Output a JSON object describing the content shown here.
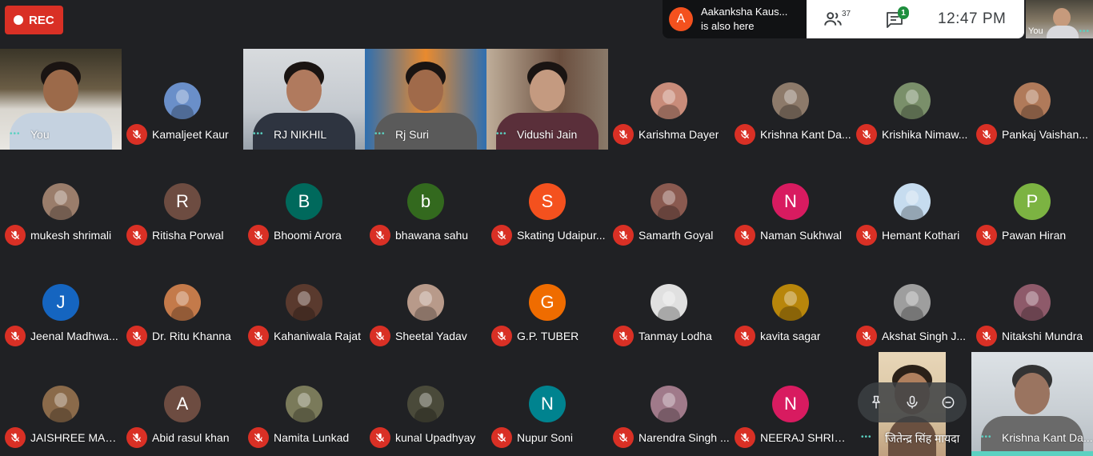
{
  "recording": {
    "label": "REC"
  },
  "join_notice": {
    "initial": "A",
    "name": "Aakanksha Kaus...",
    "message": "is also here",
    "color": "#f4511e"
  },
  "toolbar": {
    "people_count": "37",
    "chat_badge": "1",
    "time": "12:47  PM"
  },
  "self_view": {
    "label": "You"
  },
  "colors": {
    "muted_red": "#d93025",
    "accent_teal": "#5bd1c1",
    "background": "#202124"
  },
  "participants": [
    {
      "name": "You",
      "kind": "video",
      "muted": false
    },
    {
      "name": "Kamaljeet Kaur",
      "kind": "photo",
      "muted": true,
      "color": "#6a8fc9"
    },
    {
      "name": "RJ NIKHIL",
      "kind": "video",
      "muted": false
    },
    {
      "name": "Rj Suri",
      "kind": "video",
      "muted": false
    },
    {
      "name": "Vidushi Jain",
      "kind": "video",
      "muted": false
    },
    {
      "name": "Karishma Dayer",
      "kind": "photo",
      "muted": true,
      "color": "#c98c7a"
    },
    {
      "name": "Krishna Kant Da...",
      "kind": "photo",
      "muted": true,
      "color": "#8d7a6a"
    },
    {
      "name": "Krishika Nimaw...",
      "kind": "photo",
      "muted": true,
      "color": "#7a8f6a"
    },
    {
      "name": "Pankaj Vaishan...",
      "kind": "photo",
      "muted": true,
      "color": "#b07a5a"
    },
    {
      "name": "mukesh shrimali",
      "kind": "photo",
      "muted": true,
      "color": "#9a7d6b"
    },
    {
      "name": "Ritisha Porwal",
      "kind": "initial",
      "initial": "R",
      "muted": true,
      "color": "#6d4c41"
    },
    {
      "name": "Bhoomi Arora",
      "kind": "initial",
      "initial": "B",
      "muted": true,
      "color": "#00695c"
    },
    {
      "name": "bhawana sahu",
      "kind": "initial",
      "initial": "b",
      "muted": true,
      "color": "#33691e"
    },
    {
      "name": "Skating Udaipur...",
      "kind": "initial",
      "initial": "S",
      "muted": true,
      "color": "#f4511e"
    },
    {
      "name": "Samarth Goyal",
      "kind": "photo",
      "muted": true,
      "color": "#8a5a50"
    },
    {
      "name": "Naman Sukhwal",
      "kind": "initial",
      "initial": "N",
      "muted": true,
      "color": "#d81b60"
    },
    {
      "name": "Hemant Kothari",
      "kind": "photo",
      "muted": true,
      "color": "#c6dcef"
    },
    {
      "name": "Pawan Hiran",
      "kind": "initial",
      "initial": "P",
      "muted": true,
      "color": "#7cb342"
    },
    {
      "name": "Jeenal Madhwa...",
      "kind": "initial",
      "initial": "J",
      "muted": true,
      "color": "#1565c0"
    },
    {
      "name": "Dr. Ritu Khanna",
      "kind": "photo",
      "muted": true,
      "color": "#c47a4a"
    },
    {
      "name": "Kahaniwala Rajat",
      "kind": "photo",
      "muted": true,
      "color": "#5a3a2e"
    },
    {
      "name": "Sheetal Yadav",
      "kind": "photo",
      "muted": true,
      "color": "#b89a8a"
    },
    {
      "name": "G.P. TUBER",
      "kind": "initial",
      "initial": "G",
      "muted": true,
      "color": "#ef6c00"
    },
    {
      "name": "Tanmay Lodha",
      "kind": "photo",
      "muted": true,
      "color": "#e0e0e0"
    },
    {
      "name": "kavita sagar",
      "kind": "photo",
      "muted": true,
      "color": "#b8860b"
    },
    {
      "name": "Akshat Singh J...",
      "kind": "photo",
      "muted": true,
      "color": "#9e9e9e"
    },
    {
      "name": "Nitakshi Mundra",
      "kind": "photo",
      "muted": true,
      "color": "#8e5a6a"
    },
    {
      "name": "JAISHREE MAN...",
      "kind": "photo",
      "muted": true,
      "color": "#8a6a4a"
    },
    {
      "name": "Abid rasul khan",
      "kind": "initial",
      "initial": "A",
      "muted": true,
      "color": "#6d4c41"
    },
    {
      "name": "Namita Lunkad",
      "kind": "photo",
      "muted": true,
      "color": "#7a7a5a"
    },
    {
      "name": "kunal Upadhyay",
      "kind": "photo",
      "muted": true,
      "color": "#4a4a3a"
    },
    {
      "name": "Nupur Soni",
      "kind": "initial",
      "initial": "N",
      "muted": true,
      "color": "#00838f"
    },
    {
      "name": "Narendra Singh ...",
      "kind": "photo",
      "muted": true,
      "color": "#a07a8a"
    },
    {
      "name": "NEERAJ SHRIM...",
      "kind": "initial",
      "initial": "N",
      "muted": true,
      "color": "#d81b60"
    },
    {
      "name": "जितेन्द्र सिंह मायदा",
      "kind": "video",
      "muted": false
    },
    {
      "name": "Krishna Kant Da...",
      "kind": "video",
      "muted": false
    }
  ]
}
